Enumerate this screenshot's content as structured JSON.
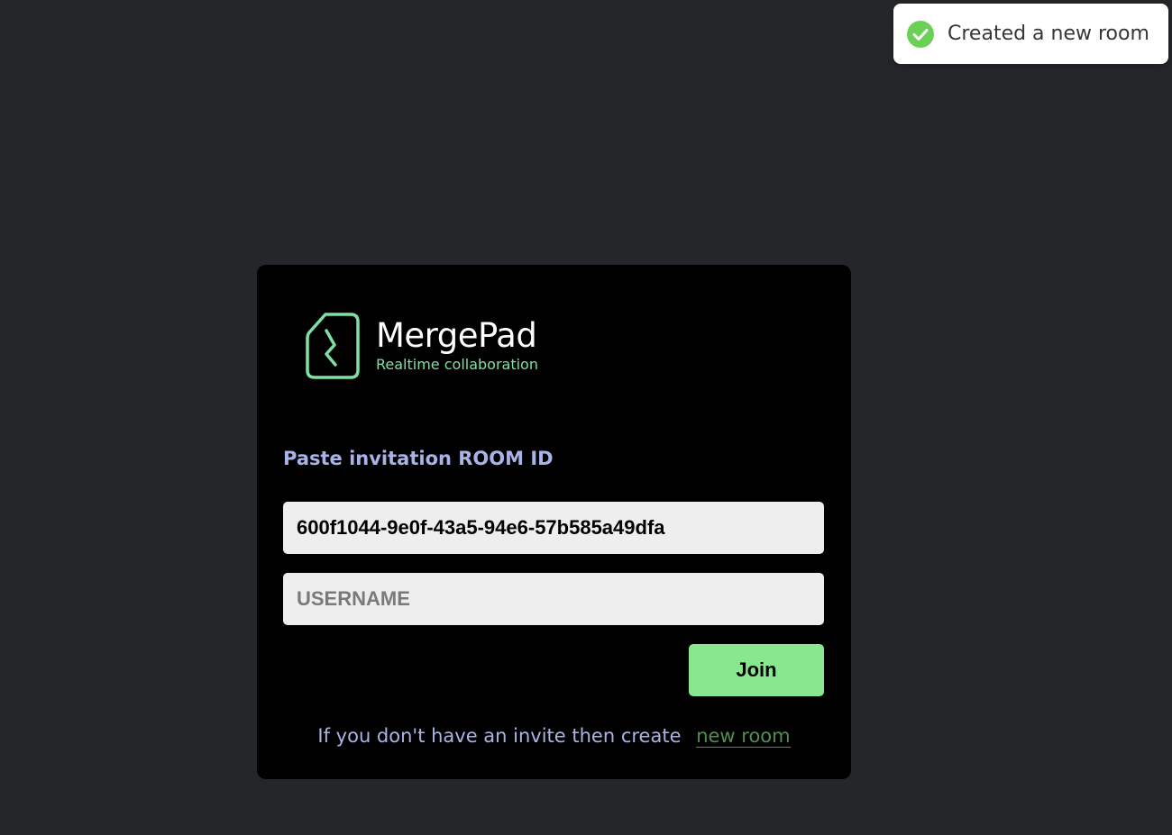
{
  "toast": {
    "message": "Created a new room",
    "icon": "check-circle-icon",
    "icon_color": "#6ccf56"
  },
  "logo": {
    "name": "MergePad",
    "tagline": "Realtime collaboration",
    "mark_color": "#7ee0a3"
  },
  "form": {
    "main_label": "Paste invitation ROOM ID",
    "room_id_value": "600f1044-9e0f-43a5-94e6-57b585a49dfa",
    "username_placeholder": "USERNAME",
    "join_label": "Join"
  },
  "footer": {
    "prompt_text": "If you don't have an invite then create",
    "link_text": "new room"
  },
  "colors": {
    "background": "#25262a",
    "card": "#000000",
    "accent_green": "#88e88e",
    "label_blue": "#aab3e8"
  }
}
